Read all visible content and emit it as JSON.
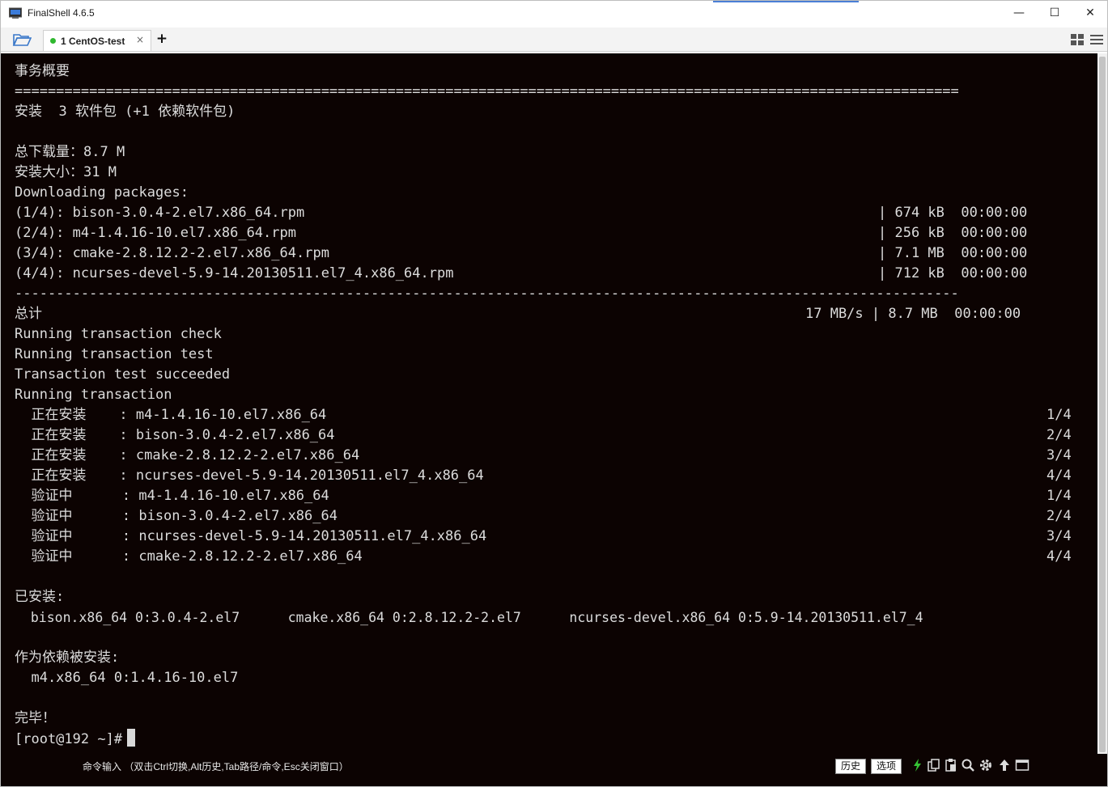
{
  "window": {
    "title": "FinalShell 4.6.5",
    "minimize_glyph": "—",
    "maximize_glyph": "☐",
    "close_glyph": "✕"
  },
  "tabs": {
    "active_tab_label": "1 CentOS-test",
    "close_glyph": "×",
    "add_glyph": "+"
  },
  "terminal": {
    "lines": [
      "事务概要",
      "==================================================================================================================",
      "安装  3 软件包 (+1 依赖软件包)",
      "",
      "总下载量：8.7 M",
      "安装大小：31 M",
      "Downloading packages:",
      "(1/4): bison-3.0.4-2.el7.x86_64.rpm",
      "(2/4): m4-1.4.16-10.el7.x86_64.rpm",
      "(3/4): cmake-2.8.12.2-2.el7.x86_64.rpm",
      "(4/4): ncurses-devel-5.9-14.20130511.el7_4.x86_64.rpm",
      "------------------------------------------------------------------------------------------------------------------",
      "总计",
      "Running transaction check",
      "Running transaction test",
      "Transaction test succeeded",
      "Running transaction",
      "  正在安装    : m4-1.4.16-10.el7.x86_64",
      "  正在安装    : bison-3.0.4-2.el7.x86_64",
      "  正在安装    : cmake-2.8.12.2-2.el7.x86_64",
      "  正在安装    : ncurses-devel-5.9-14.20130511.el7_4.x86_64",
      "  验证中      : m4-1.4.16-10.el7.x86_64",
      "  验证中      : bison-3.0.4-2.el7.x86_64",
      "  验证中      : ncurses-devel-5.9-14.20130511.el7_4.x86_64",
      "  验证中      : cmake-2.8.12.2-2.el7.x86_64",
      "",
      "已安装:",
      "  bison.x86_64 0:3.0.4-2.el7      cmake.x86_64 0:2.8.12.2-2.el7      ncurses-devel.x86_64 0:5.9-14.20130511.el7_4",
      "",
      "作为依赖被安装:",
      "  m4.x86_64 0:1.4.16-10.el7",
      "",
      "完毕！",
      "[root@192 ~]#"
    ],
    "downloads_right": [
      "| 674 kB  00:00:00",
      "| 256 kB  00:00:00",
      "| 7.1 MB  00:00:00",
      "| 712 kB  00:00:00"
    ],
    "total_right": "17 MB/s | 8.7 MB  00:00:00",
    "progress_right": [
      "1/4",
      "2/4",
      "3/4",
      "4/4",
      "1/4",
      "2/4",
      "3/4",
      "4/4"
    ]
  },
  "command_bar": {
    "hint": "命令输入 （双击Ctrl切换,Alt历史,Tab路径/命令,Esc关闭窗口）",
    "history_button": "历史",
    "options_button": "选项"
  },
  "colors": {
    "terminal_bg": "#0c0302",
    "terminal_fg": "#dcdcdc",
    "tab_status_dot": "#2fb82f",
    "lightning_icon": "#35c235"
  }
}
